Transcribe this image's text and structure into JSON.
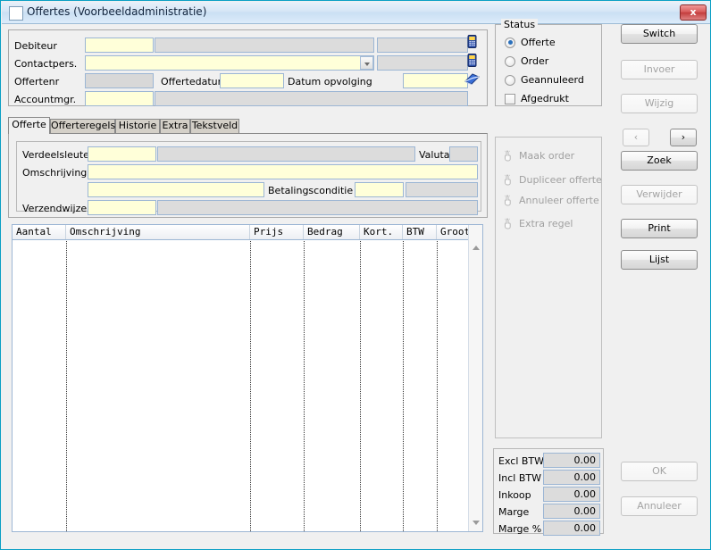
{
  "window": {
    "title": "Offertes (Voorbeeldadministratie)",
    "close_label": "x",
    "icon": "window-icon"
  },
  "header_form": {
    "fields": [
      {
        "label": "Debiteur",
        "value": "",
        "readonly_value": "",
        "extra_value": ""
      },
      {
        "label": "Contactpers.",
        "value": "",
        "readonly_value": ""
      },
      {
        "label": "Offertenr",
        "value": ""
      },
      {
        "label": "Accountmgr.",
        "value": "",
        "readonly_value": ""
      }
    ],
    "offertedatum_label": "Offertedatum",
    "offertedatum_value": "",
    "datum_opvolging_label": "Datum opvolging",
    "datum_opvolging_value": "",
    "icons": [
      "phone-icon",
      "phone-icon",
      "envelope-icon"
    ]
  },
  "status": {
    "legend": "Status",
    "options": [
      {
        "label": "Offerte",
        "selected": true
      },
      {
        "label": "Order",
        "selected": false
      },
      {
        "label": "Geannuleerd",
        "selected": false
      }
    ],
    "checkbox": {
      "label": "Afgedrukt",
      "checked": false
    }
  },
  "tabs": [
    {
      "label": "Offerte",
      "active": true
    },
    {
      "label": "Offerteregels",
      "active": false
    },
    {
      "label": "Historie",
      "active": false
    },
    {
      "label": "Extra",
      "active": false
    },
    {
      "label": "Tekstveld",
      "active": false
    }
  ],
  "detail_form": {
    "verdeelsleutel_label": "Verdeelsleutel",
    "verdeelsleutel_value": "",
    "verdeelsleutel_desc": "",
    "valuta_label": "Valuta",
    "valuta_value": "",
    "omschrijving_label": "Omschrijving",
    "omschrijving_value1": "",
    "omschrijving_value2": "",
    "betalingsconditie_label": "Betalingsconditie",
    "betalingsconditie_value": "",
    "betalingsconditie_desc": "",
    "verzendwijze_label": "Verzendwijze",
    "verzendwijze_value": "",
    "verzendwijze_desc": ""
  },
  "grid": {
    "columns": [
      {
        "label": "Aantal"
      },
      {
        "label": "Omschrijving"
      },
      {
        "label": "Prijs"
      },
      {
        "label": "Bedrag"
      },
      {
        "label": "Kort."
      },
      {
        "label": "BTW"
      },
      {
        "label": "Grootboek"
      }
    ],
    "rows": []
  },
  "actions": [
    {
      "label": "Maak order",
      "icon": "hand-click-icon",
      "enabled": false
    },
    {
      "label": "Dupliceer offerte",
      "icon": "hand-click-icon",
      "enabled": false
    },
    {
      "label": "Annuleer offerte",
      "icon": "hand-click-icon",
      "enabled": false
    },
    {
      "label": "Extra regel",
      "icon": "hand-click-icon",
      "enabled": false
    }
  ],
  "totals": [
    {
      "label": "Excl BTW",
      "value": "0.00"
    },
    {
      "label": "Incl BTW",
      "value": "0.00"
    },
    {
      "label": "Inkoop",
      "value": "0.00"
    },
    {
      "label": "Marge",
      "value": "0.00"
    },
    {
      "label": "Marge %",
      "value": "0.00"
    }
  ],
  "right_buttons": {
    "switch": {
      "label": "Switch",
      "enabled": true
    },
    "invoer": {
      "label": "Invoer",
      "enabled": false
    },
    "wijzig": {
      "label": "Wijzig",
      "enabled": false
    },
    "prev": {
      "label": "‹",
      "enabled": false
    },
    "next": {
      "label": "›",
      "enabled": true
    },
    "zoek": {
      "label": "Zoek",
      "enabled": true
    },
    "verwijder": {
      "label": "Verwijder",
      "enabled": false
    },
    "print": {
      "label": "Print",
      "enabled": true
    },
    "lijst": {
      "label": "Lijst",
      "enabled": true
    },
    "ok": {
      "label": "OK",
      "enabled": false
    },
    "annuleer": {
      "label": "Annuleer",
      "enabled": false
    }
  },
  "colors": {
    "accent": "#0a9fc4",
    "field_edit": "#ffffd9",
    "field_readonly": "#dcdcdc",
    "field_border": "#9cb6d4",
    "window_bg": "#f0f0f0",
    "close_red": "#c33d3d",
    "radio_dot": "#2a6fbb"
  }
}
